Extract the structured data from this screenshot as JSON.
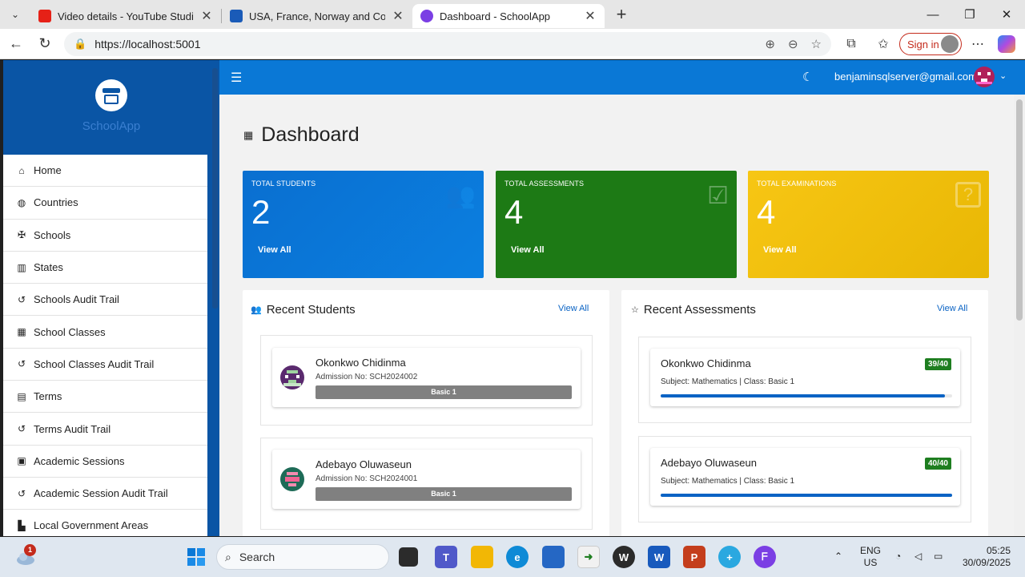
{
  "browser": {
    "tabs": [
      {
        "title": "Video details - YouTube Studio",
        "fav_color": "#e62117",
        "active": false
      },
      {
        "title": "USA, France, Norway and Colomb",
        "fav_color": "#1a5bb8",
        "active": false
      },
      {
        "title": "Dashboard - SchoolApp",
        "fav_color": "#7b3fe4",
        "active": true
      }
    ],
    "close_glyph": "✕",
    "new_tab_glyph": "+",
    "url": "https://localhost:5001",
    "sign_in_label": "Sign in",
    "icons": [
      "back-icon",
      "refresh-icon",
      "zoom-icon",
      "reader-icon",
      "favorite-icon",
      "extensions-icon",
      "favorites-list-icon",
      "more-icon",
      "copilot-icon"
    ]
  },
  "app": {
    "brand_name": "SchoolApp",
    "user_email": "benjaminsqlserver@gmail.com",
    "page_title": "Dashboard",
    "sidebar": {
      "items": [
        {
          "label": "Home",
          "icon": "home-icon",
          "glyph": "⌂"
        },
        {
          "label": "Countries",
          "icon": "globe-icon",
          "glyph": "◍"
        },
        {
          "label": "Schools",
          "icon": "graduation-cap-icon",
          "glyph": "✠"
        },
        {
          "label": "States",
          "icon": "map-icon",
          "glyph": "▥"
        },
        {
          "label": "Schools Audit Trail",
          "icon": "history-icon",
          "glyph": "↺"
        },
        {
          "label": "School Classes",
          "icon": "building-icon",
          "glyph": "▦"
        },
        {
          "label": "School Classes Audit Trail",
          "icon": "history-icon",
          "glyph": "↺"
        },
        {
          "label": "Terms",
          "icon": "calendar-icon",
          "glyph": "▤"
        },
        {
          "label": "Terms Audit Trail",
          "icon": "history-icon",
          "glyph": "↺"
        },
        {
          "label": "Academic Sessions",
          "icon": "calendar-check-icon",
          "glyph": "▣"
        },
        {
          "label": "Academic Session Audit Trail",
          "icon": "history-icon",
          "glyph": "↺"
        },
        {
          "label": "Local Government Areas",
          "icon": "city-icon",
          "glyph": "▙"
        }
      ]
    },
    "stats": [
      {
        "label": "TOTAL STUDENTS",
        "value": "2",
        "link": "View All",
        "color": "#0a6fd0",
        "icon": "users-icon",
        "glyph": "👥"
      },
      {
        "label": "TOTAL ASSESSMENTS",
        "value": "4",
        "link": "View All",
        "color": "#1d7a15",
        "icon": "checklist-icon",
        "glyph": "☑"
      },
      {
        "label": "TOTAL EXAMINATIONS",
        "value": "4",
        "link": "View All",
        "color": "#f2c10b",
        "icon": "question-icon",
        "glyph": "?"
      }
    ],
    "recent_students": {
      "title": "Recent Students",
      "link": "View All",
      "items": [
        {
          "name": "Okonkwo Chidinma",
          "admission": "Admission No: SCH2024002",
          "class": "Basic 1",
          "avatar_color": "#5a2a6e"
        },
        {
          "name": "Adebayo Oluwaseun",
          "admission": "Admission No: SCH2024001",
          "class": "Basic 1",
          "avatar_color": "#1e6b57"
        }
      ]
    },
    "recent_assessments": {
      "title": "Recent Assessments",
      "link": "View All",
      "items": [
        {
          "name": "Okonkwo Chidinma",
          "details": "Subject: Mathematics | Class: Basic 1",
          "score": "39/40",
          "progress": 0.975
        },
        {
          "name": "Adebayo Oluwaseun",
          "details": "Subject: Mathematics | Class: Basic 1",
          "score": "40/40",
          "progress": 1.0
        }
      ]
    }
  },
  "taskbar": {
    "search_placeholder": "Search",
    "weather_badge": "1",
    "language": "ENG",
    "region": "US",
    "time": "05:25",
    "date": "30/09/2025"
  }
}
